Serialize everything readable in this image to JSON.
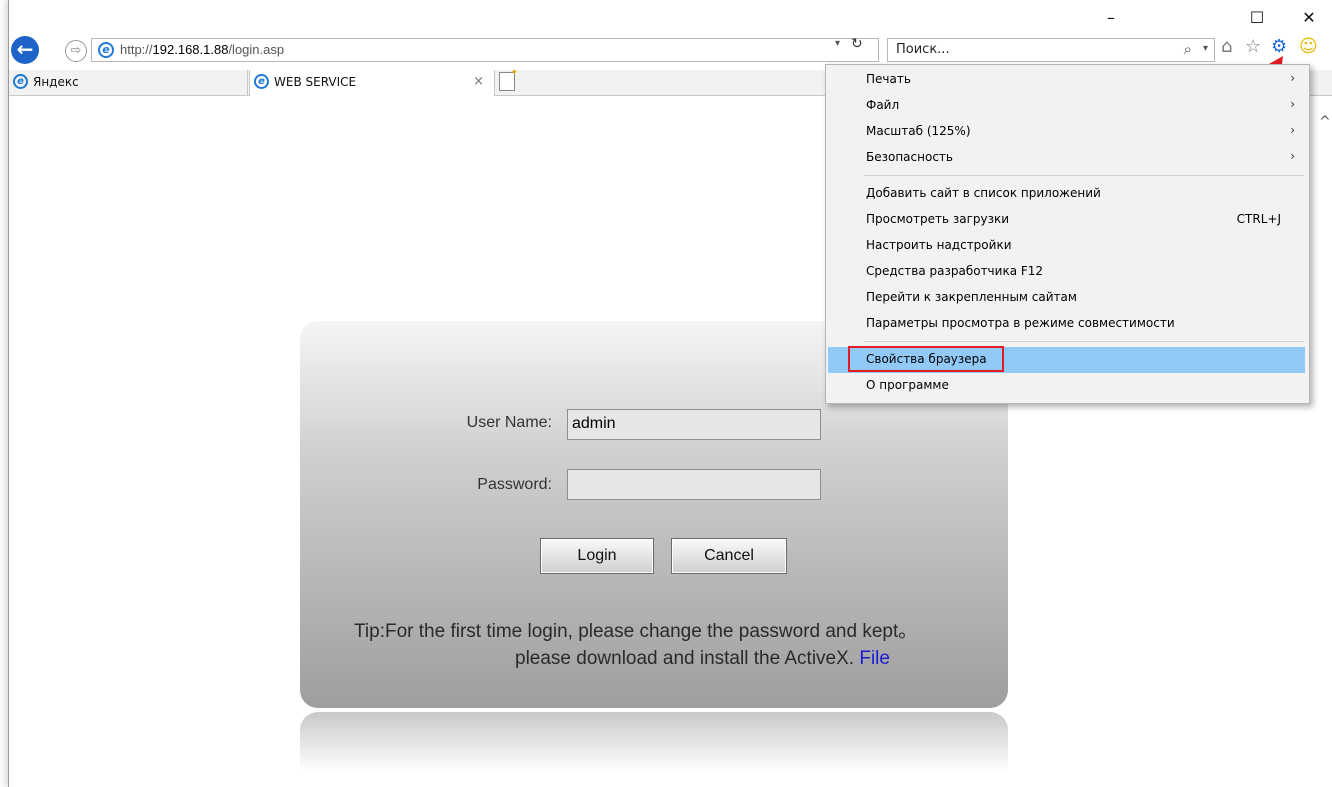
{
  "window": {
    "minimize": "–",
    "maximize": "☐",
    "close": "✕"
  },
  "nav": {
    "address_scheme": "http://",
    "address_host": "192.168.1.88",
    "address_path": "/login.asp",
    "search_placeholder": "Поиск...",
    "back_icon": "back-arrow-icon",
    "forward_icon": "forward-arrow-icon"
  },
  "tabs": [
    {
      "label": "Яндекс"
    },
    {
      "label": "WEB SERVICE",
      "close": "×"
    }
  ],
  "login": {
    "username_label": "User Name:",
    "username_value": "admin",
    "password_label": "Password:",
    "password_value": "",
    "login_button": "Login",
    "cancel_button": "Cancel",
    "tip_line1": "Tip:For the first time login, please change the password and kept。",
    "tip_line2": "please download and install the ActiveX. ",
    "tip_link": "File"
  },
  "menu": {
    "items": [
      {
        "label": "Печать",
        "submenu": true
      },
      {
        "label": "Файл",
        "submenu": true
      },
      {
        "label": "Масштаб (125%)",
        "submenu": true
      },
      {
        "label": "Безопасность",
        "submenu": true
      },
      {
        "label": "Добавить сайт в список приложений"
      },
      {
        "label": "Просмотреть загрузки",
        "shortcut": "CTRL+J"
      },
      {
        "label": "Настроить надстройки"
      },
      {
        "label": "Средства разработчика F12"
      },
      {
        "label": "Перейти к закрепленным сайтам"
      },
      {
        "label": "Параметры просмотра в режиме совместимости"
      },
      {
        "label": "Свойства браузера",
        "highlighted": true
      },
      {
        "label": "О программе"
      }
    ]
  },
  "colors": {
    "accent": "#1e64c8",
    "highlight": "#91c9f7",
    "annotation": "#e31b23"
  }
}
